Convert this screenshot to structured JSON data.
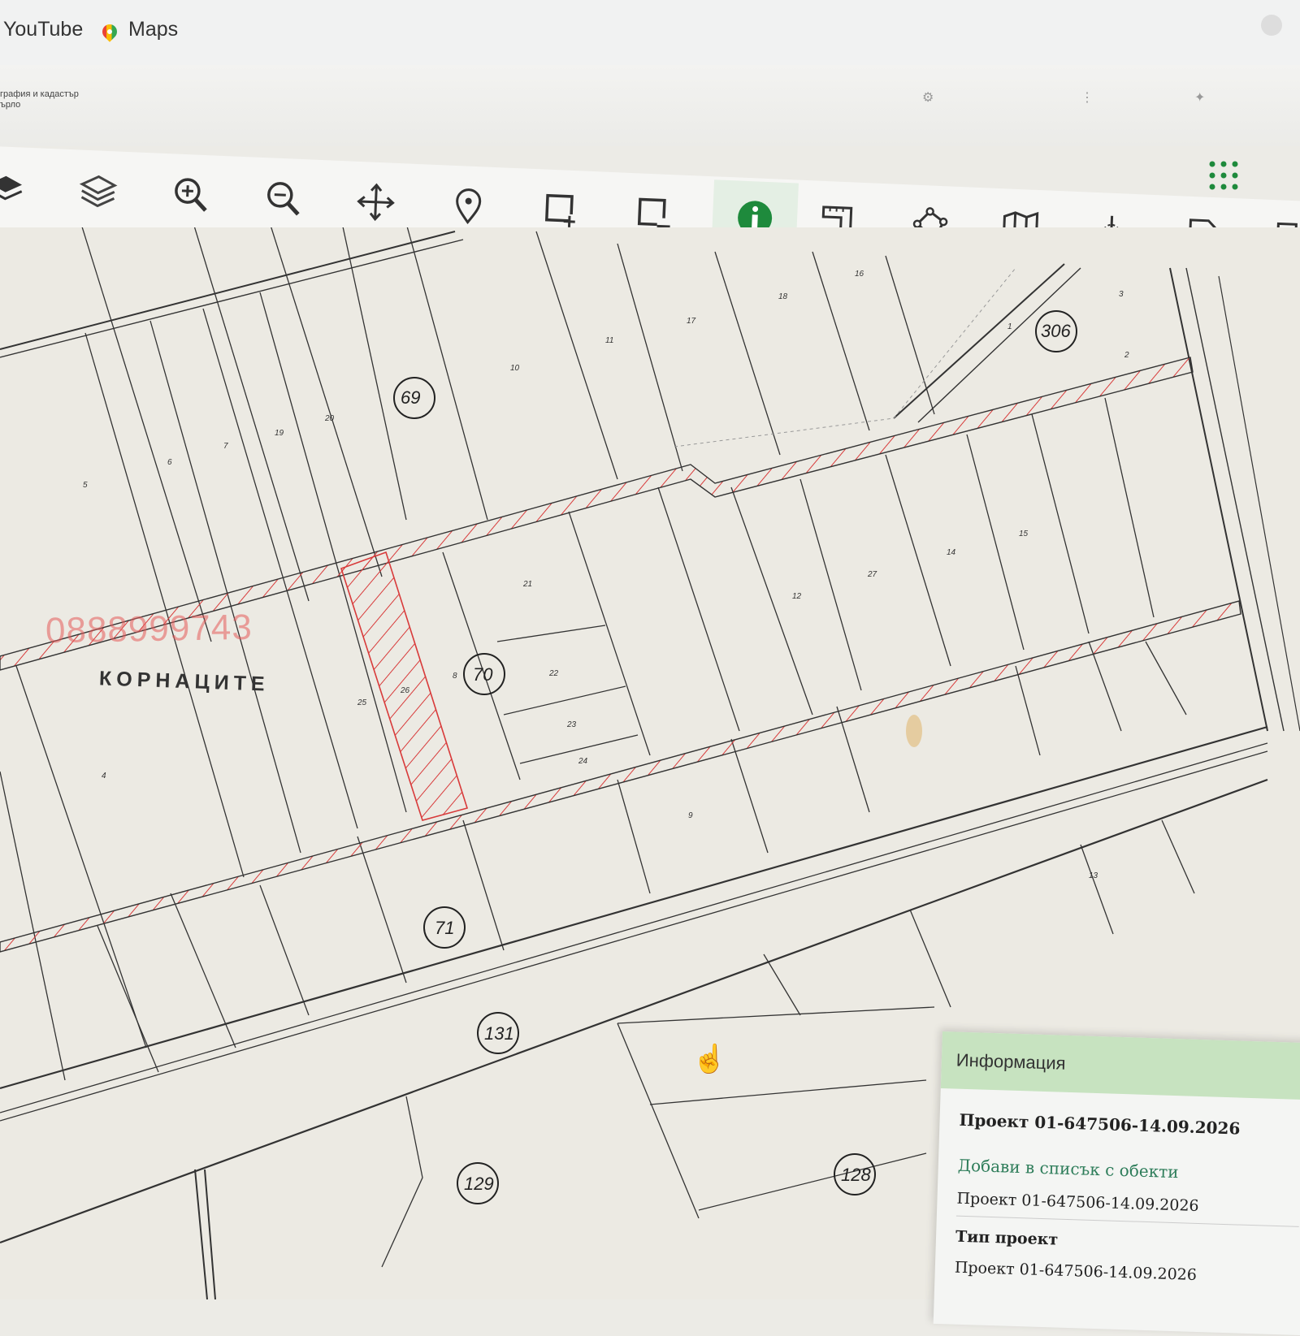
{
  "bookmarks": {
    "youtube": "YouTube",
    "maps": "Maps"
  },
  "app": {
    "title_line1": "графия и кадастър",
    "title_line2": "ърло"
  },
  "toolbar": {
    "tools": [
      "base-layers-icon",
      "layers-icon",
      "zoom-in-icon",
      "zoom-out-icon",
      "pan-icon",
      "location-pin-icon",
      "add-selection-icon",
      "remove-selection-icon",
      "info-icon",
      "measure-icon",
      "polygon-icon",
      "map-icon",
      "coordinates-icon",
      "export-icon",
      "print-icon",
      "apps-grid-icon"
    ],
    "active_tool": "info-icon",
    "accent_color": "#1e8a3c"
  },
  "map": {
    "locality": "КОРНАЦИТЕ",
    "watermark_phone": "0888999743",
    "blocks": [
      "69",
      "70",
      "71",
      "306",
      "131",
      "129",
      "128"
    ],
    "parcel_numbers": [
      "11",
      "10",
      "17",
      "18",
      "16",
      "3",
      "1",
      "2",
      "20",
      "19",
      "7",
      "6",
      "5",
      "21",
      "22",
      "23",
      "24",
      "25",
      "26",
      "8",
      "9",
      "12",
      "27",
      "14",
      "15",
      "13",
      "4"
    ]
  },
  "info_panel": {
    "header": "Информация",
    "title": "Проект 01-647506-14.09.2026",
    "add_link": "Добави в списък с обекти",
    "project_value": "Проект 01-647506-14.09.2026",
    "type_label": "Тип проект",
    "type_value": "Проект 01-647506-14.09.2026"
  }
}
